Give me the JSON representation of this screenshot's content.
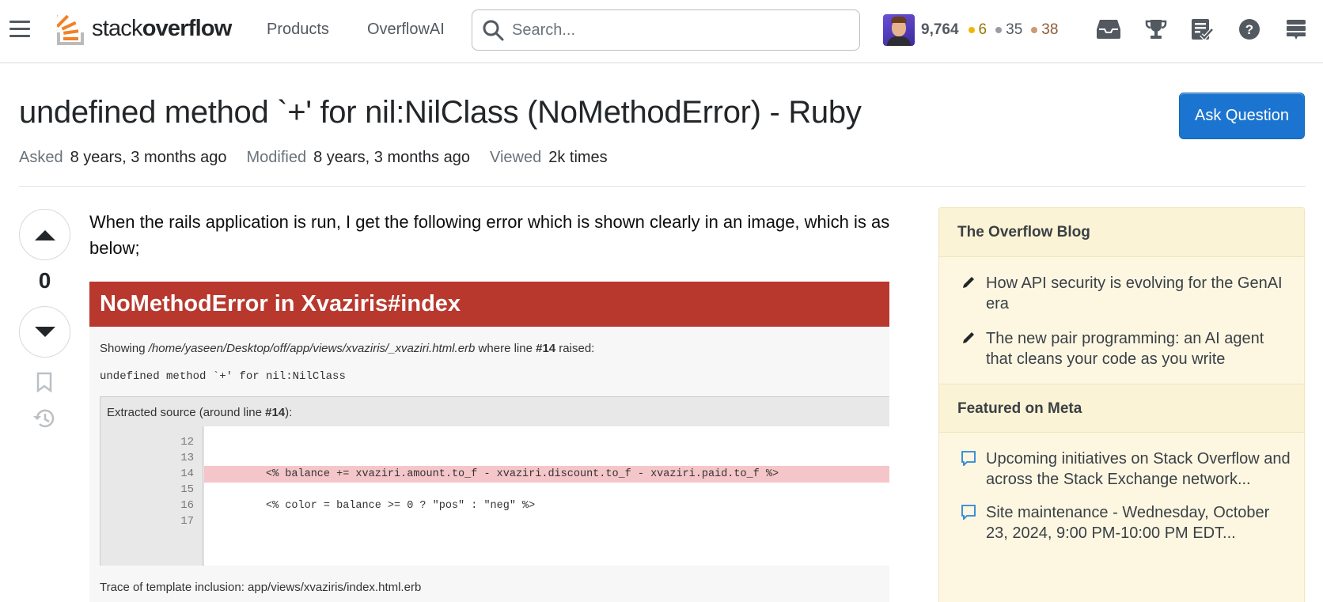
{
  "topbar": {
    "brand_light": "stack",
    "brand_bold": "overflow",
    "nav": [
      "Products",
      "OverflowAI"
    ],
    "search_placeholder": "Search...",
    "reputation": "9,764",
    "badges": {
      "gold": "6",
      "silver": "35",
      "bronze": "38"
    },
    "icons": [
      "hamburger-icon",
      "search-icon",
      "inbox-icon",
      "achievements-icon",
      "review-queue-icon",
      "help-icon",
      "site-switcher-icon"
    ]
  },
  "question": {
    "title": "undefined method `+' for nil:NilClass (NoMethodError) - Ruby",
    "meta": [
      {
        "label": "Asked",
        "value": "8 years, 3 months ago"
      },
      {
        "label": "Modified",
        "value": "8 years, 3 months ago"
      },
      {
        "label": "Viewed",
        "value": "2k times"
      }
    ],
    "score": "0",
    "body_text": "When the rails application is run, I get the following error which is shown clearly in an image, which is as below;",
    "ask_button": "Ask Question"
  },
  "error_screenshot": {
    "heading": "NoMethodError in Xvaziris#index",
    "showing_prefix": "Showing ",
    "showing_path": "/home/yaseen/Desktop/off/app/views/xvaziris/_xvaziri.html.erb",
    "showing_mid": " where line ",
    "showing_line": "#14",
    "showing_suffix": " raised:",
    "message": "undefined method `+' for nil:NilClass",
    "source_label_prefix": "Extracted source (around line ",
    "source_label_line": "#14",
    "source_label_suffix": "):",
    "source_lines": [
      {
        "num": "12",
        "code": "",
        "highlight": false
      },
      {
        "num": "13",
        "code": "",
        "highlight": false
      },
      {
        "num": "14",
        "code": "<% balance += xvaziri.amount.to_f - xvaziri.discount.to_f - xvaziri.paid.to_f %>",
        "highlight": true
      },
      {
        "num": "15",
        "code": "",
        "highlight": false
      },
      {
        "num": "16",
        "code": "<% color = balance >= 0 ? \"pos\" : \"neg\" %>",
        "highlight": false
      },
      {
        "num": "17",
        "code": "",
        "highlight": false
      }
    ],
    "trace": "Trace of template inclusion: app/views/xvaziris/index.html.erb"
  },
  "sidebar": {
    "blog_heading": "The Overflow Blog",
    "blog_items": [
      "How API security is evolving for the GenAI era",
      "The new pair programming: an AI agent that cleans your code as you write"
    ],
    "meta_heading": "Featured on Meta",
    "meta_items": [
      "Upcoming initiatives on Stack Overflow and across the Stack Exchange network...",
      "Site maintenance - Wednesday, October 23, 2024, 9:00 PM-10:00 PM EDT..."
    ]
  },
  "colors": {
    "accent": "#1b75d0",
    "brand_orange": "#f48024",
    "error_red": "#b8382e",
    "sidebar_bg": "#fdf7e2"
  }
}
